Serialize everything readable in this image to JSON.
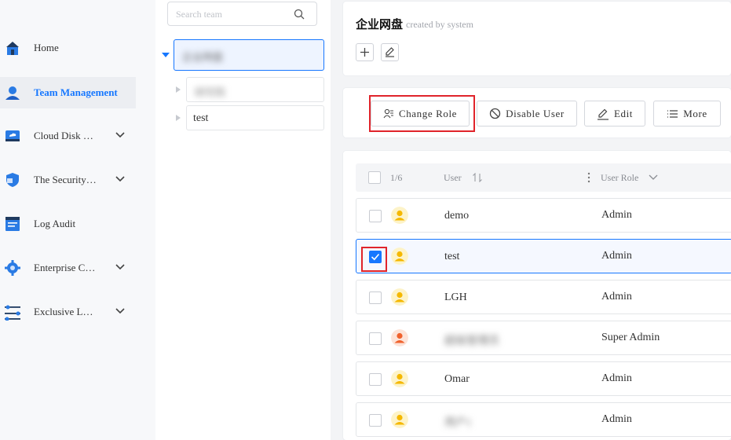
{
  "nav": {
    "items": [
      {
        "label": "Home",
        "icon": "home-icon",
        "active": false,
        "expandable": false
      },
      {
        "label": "Team Management",
        "icon": "team-user-icon",
        "active": true,
        "expandable": false
      },
      {
        "label": "Cloud Disk …",
        "icon": "cloud-disk-icon",
        "active": false,
        "expandable": true
      },
      {
        "label": "The Security…",
        "icon": "shield-icon",
        "active": false,
        "expandable": true
      },
      {
        "label": "Log Audit",
        "icon": "log-document-icon",
        "active": false,
        "expandable": false
      },
      {
        "label": "Enterprise C…",
        "icon": "gear-icon",
        "active": false,
        "expandable": true
      },
      {
        "label": "Exclusive L…",
        "icon": "sliders-icon",
        "active": false,
        "expandable": true
      }
    ]
  },
  "team_tree": {
    "search_placeholder": "Search team",
    "root_label": "企业网盘",
    "children": [
      {
        "label": "研究院",
        "blurred": true
      },
      {
        "label": "test",
        "blurred": false
      }
    ]
  },
  "header": {
    "title": "企业网盘",
    "subtitle": "created by system"
  },
  "toolbar": {
    "change_role": "Change Role",
    "disable_user": "Disable User",
    "edit": "Edit",
    "more": "More"
  },
  "table": {
    "count": "1/6",
    "col_user": "User",
    "col_role": "User Role",
    "rows": [
      {
        "user": "demo",
        "role": "Admin",
        "checked": false,
        "blurred": false,
        "avatar_color": "#f5b800"
      },
      {
        "user": "test",
        "role": "Admin",
        "checked": true,
        "blurred": false,
        "avatar_color": "#f5b800"
      },
      {
        "user": "LGH",
        "role": "Admin",
        "checked": false,
        "blurred": false,
        "avatar_color": "#f5b800"
      },
      {
        "user": "超级管理员",
        "role": "Super Admin",
        "checked": false,
        "blurred": true,
        "avatar_color": "#f0622d"
      },
      {
        "user": "Omar",
        "role": "Admin",
        "checked": false,
        "blurred": false,
        "avatar_color": "#f5b800"
      },
      {
        "user": "用户1",
        "role": "Admin",
        "checked": false,
        "blurred": true,
        "avatar_color": "#f5b800"
      }
    ]
  },
  "colors": {
    "accent": "#1677ff",
    "highlight": "#e0242b",
    "avatar_admin": "#f5b800",
    "avatar_super": "#f0622d"
  }
}
